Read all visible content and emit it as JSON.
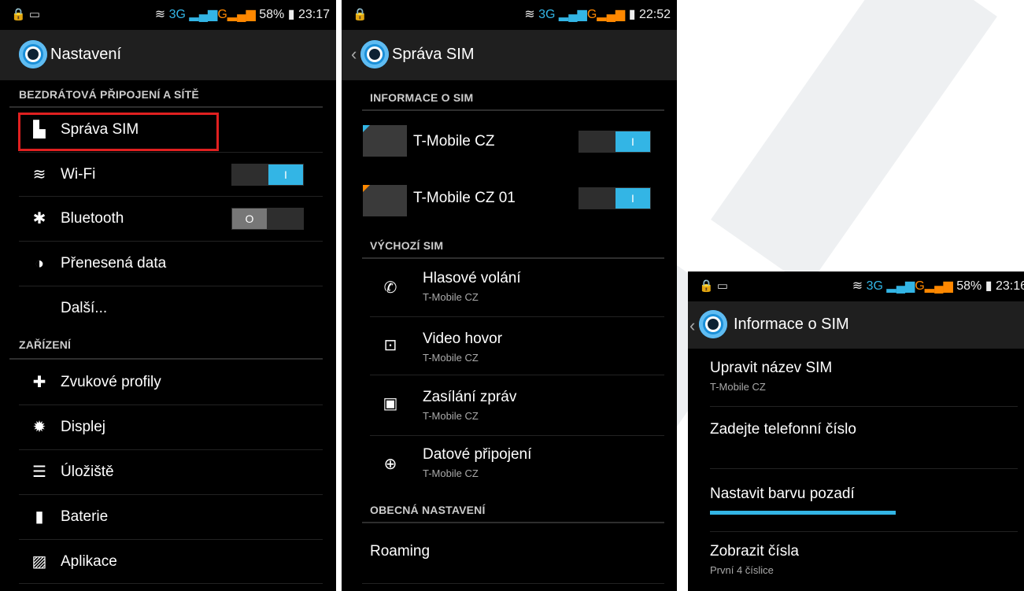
{
  "screen1": {
    "status": {
      "left_icons": "🔒 ▭",
      "network": "3G",
      "battery": "58%",
      "time": "23:17"
    },
    "title": "Nastavení",
    "sections": {
      "wireless": "BEZDRÁTOVÁ PŘIPOJENÍ A SÍTĚ",
      "device": "ZAŘÍZENÍ"
    },
    "items": [
      {
        "label": "Správa SIM",
        "icon": "sim-icon"
      },
      {
        "label": "Wi-Fi",
        "icon": "wifi-icon",
        "toggle": "I"
      },
      {
        "label": "Bluetooth",
        "icon": "bluetooth-icon",
        "toggle": "O"
      },
      {
        "label": "Přenesená data",
        "icon": "data-usage-icon"
      },
      {
        "label": "Další...",
        "icon": ""
      },
      {
        "label": "Zvukové profily",
        "icon": "sound-icon"
      },
      {
        "label": "Displej",
        "icon": "display-icon"
      },
      {
        "label": "Úložiště",
        "icon": "storage-icon"
      },
      {
        "label": "Baterie",
        "icon": "battery-icon"
      },
      {
        "label": "Aplikace",
        "icon": "apps-icon"
      }
    ]
  },
  "screen2": {
    "status": {
      "left_icons": "🔒",
      "network": "3G",
      "time": "22:52"
    },
    "title": "Správa SIM",
    "sections": {
      "info": "INFORMACE O SIM",
      "default": "VÝCHOZÍ SIM",
      "general": "OBECNÁ NASTAVENÍ"
    },
    "sims": [
      {
        "name": "T-Mobile CZ",
        "toggle": "I",
        "color": "#33b5e5"
      },
      {
        "name": "T-Mobile CZ 01",
        "toggle": "I",
        "color": "#ff8800"
      }
    ],
    "defaults": [
      {
        "label": "Hlasové volání",
        "sub": "T-Mobile CZ",
        "icon": "phone-icon"
      },
      {
        "label": "Video hovor",
        "sub": "T-Mobile CZ",
        "icon": "video-call-icon"
      },
      {
        "label": "Zasílání zpráv",
        "sub": "T-Mobile CZ",
        "icon": "message-icon"
      },
      {
        "label": "Datové připojení",
        "sub": "T-Mobile CZ",
        "icon": "globe-icon"
      }
    ],
    "roaming": "Roaming"
  },
  "screen3": {
    "status": {
      "left_icons": "🔒 ▭",
      "network": "3G",
      "battery": "58%",
      "time": "23:16"
    },
    "title": "Informace o SIM",
    "items": [
      {
        "label": "Upravit název SIM",
        "sub": "T-Mobile CZ"
      },
      {
        "label": "Zadejte telefonní číslo",
        "sub": ""
      },
      {
        "label": "Nastavit barvu pozadí",
        "sub": ""
      },
      {
        "label": "Zobrazit čísla",
        "sub": "První 4 číslice"
      }
    ]
  },
  "colors": {
    "accent": "#33b5e5",
    "highlight": "#e02020",
    "sim2": "#ff8800"
  }
}
